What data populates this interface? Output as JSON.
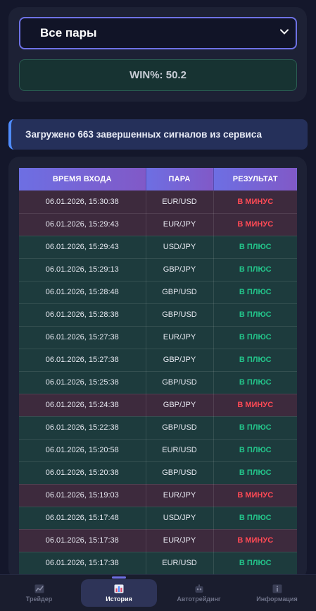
{
  "filter": {
    "selected_pair": "Все пары",
    "winrate_label": "WIN%: 50.2"
  },
  "banner": {
    "text": "Загружено 663 завершенных сигналов из сервиса"
  },
  "table": {
    "headers": [
      "Время входа",
      "Пара",
      "Результат"
    ],
    "rows": [
      {
        "time": "06.01.2026, 15:30:38",
        "pair": "EUR/USD",
        "result": "В МИНУС",
        "status": "loss"
      },
      {
        "time": "06.01.2026, 15:29:43",
        "pair": "EUR/JPY",
        "result": "В МИНУС",
        "status": "loss"
      },
      {
        "time": "06.01.2026, 15:29:43",
        "pair": "USD/JPY",
        "result": "В ПЛЮС",
        "status": "win"
      },
      {
        "time": "06.01.2026, 15:29:13",
        "pair": "GBP/JPY",
        "result": "В ПЛЮС",
        "status": "win"
      },
      {
        "time": "06.01.2026, 15:28:48",
        "pair": "GBP/USD",
        "result": "В ПЛЮС",
        "status": "win"
      },
      {
        "time": "06.01.2026, 15:28:38",
        "pair": "GBP/USD",
        "result": "В ПЛЮС",
        "status": "win"
      },
      {
        "time": "06.01.2026, 15:27:38",
        "pair": "EUR/JPY",
        "result": "В ПЛЮС",
        "status": "win"
      },
      {
        "time": "06.01.2026, 15:27:38",
        "pair": "GBP/JPY",
        "result": "В ПЛЮС",
        "status": "win"
      },
      {
        "time": "06.01.2026, 15:25:38",
        "pair": "GBP/USD",
        "result": "В ПЛЮС",
        "status": "win"
      },
      {
        "time": "06.01.2026, 15:24:38",
        "pair": "GBP/JPY",
        "result": "В МИНУС",
        "status": "loss"
      },
      {
        "time": "06.01.2026, 15:22:38",
        "pair": "GBP/USD",
        "result": "В ПЛЮС",
        "status": "win"
      },
      {
        "time": "06.01.2026, 15:20:58",
        "pair": "EUR/USD",
        "result": "В ПЛЮС",
        "status": "win"
      },
      {
        "time": "06.01.2026, 15:20:38",
        "pair": "GBP/USD",
        "result": "В ПЛЮС",
        "status": "win"
      },
      {
        "time": "06.01.2026, 15:19:03",
        "pair": "EUR/JPY",
        "result": "В МИНУС",
        "status": "loss"
      },
      {
        "time": "06.01.2026, 15:17:48",
        "pair": "USD/JPY",
        "result": "В ПЛЮС",
        "status": "win"
      },
      {
        "time": "06.01.2026, 15:17:38",
        "pair": "EUR/JPY",
        "result": "В МИНУС",
        "status": "loss"
      },
      {
        "time": "06.01.2026, 15:17:38",
        "pair": "EUR/USD",
        "result": "В ПЛЮС",
        "status": "win"
      }
    ]
  },
  "nav": {
    "items": [
      {
        "label": "Трейдер",
        "icon": "chart-icon"
      },
      {
        "label": "История",
        "icon": "history-icon",
        "active": true
      },
      {
        "label": "Автотрейдинг",
        "icon": "robot-icon"
      },
      {
        "label": "Информация",
        "icon": "info-icon"
      }
    ]
  },
  "colors": {
    "accent": "#6d6fe3",
    "win": "#23c48a",
    "loss": "#ff4a55"
  }
}
